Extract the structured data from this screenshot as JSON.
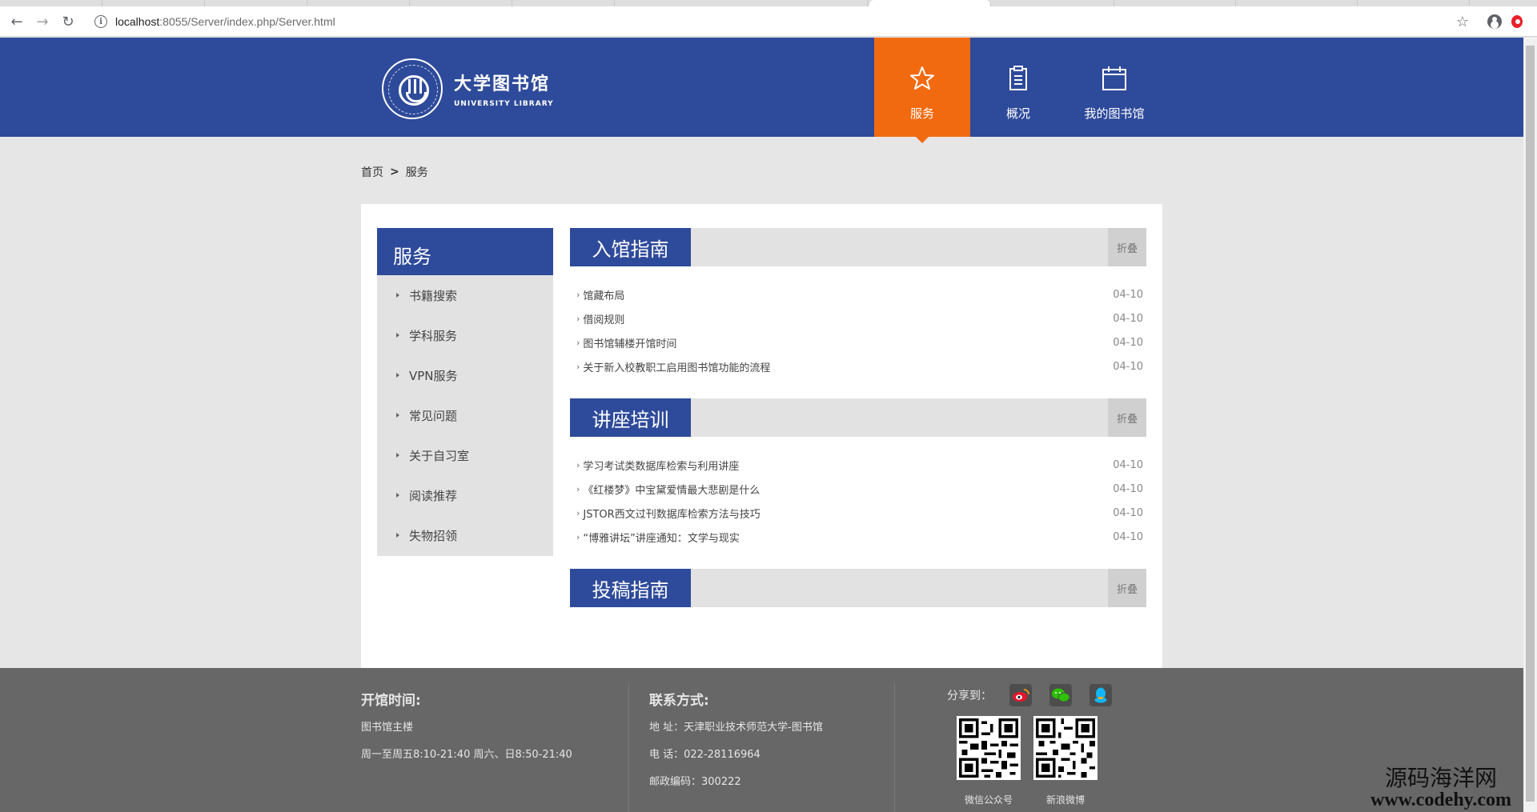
{
  "browser": {
    "url_host": "localhost",
    "url_path": ":8055/Server/index.php/Server.html"
  },
  "header": {
    "logo_cn": "大学图书馆",
    "logo_en": "UNIVERSITY LIBRARY",
    "nav": [
      {
        "label": "服务",
        "icon": "star-icon",
        "active": true
      },
      {
        "label": "概况",
        "icon": "clipboard-icon",
        "active": false
      },
      {
        "label": "我的图书馆",
        "icon": "calendar-icon",
        "active": false
      }
    ]
  },
  "breadcrumb": {
    "home": "首页",
    "separator": ">",
    "current": "服务"
  },
  "sidebar": {
    "title": "服务",
    "items": [
      {
        "label": "书籍搜索"
      },
      {
        "label": "学科服务"
      },
      {
        "label": "VPN服务"
      },
      {
        "label": "常见问题"
      },
      {
        "label": "关于自习室"
      },
      {
        "label": "阅读推荐"
      },
      {
        "label": "失物招领"
      }
    ]
  },
  "sections": [
    {
      "title": "入馆指南",
      "fold_label": "折叠",
      "items": [
        {
          "title": "馆藏布局",
          "date": "04-10"
        },
        {
          "title": "借阅规则",
          "date": "04-10"
        },
        {
          "title": "图书馆辅楼开馆时间",
          "date": "04-10"
        },
        {
          "title": "关于新入校教职工启用图书馆功能的流程",
          "date": "04-10"
        }
      ]
    },
    {
      "title": "讲座培训",
      "fold_label": "折叠",
      "items": [
        {
          "title": "学习考试类数据库检索与利用讲座",
          "date": "04-10"
        },
        {
          "title": "《红楼梦》中宝黛爱情最大悲剧是什么",
          "date": "04-10"
        },
        {
          "title": "JSTOR西文过刊数据库检索方法与技巧",
          "date": "04-10"
        },
        {
          "title": "“博雅讲坛”讲座通知：文学与现实",
          "date": "04-10"
        }
      ]
    },
    {
      "title": "投稿指南",
      "fold_label": "折叠",
      "items": []
    }
  ],
  "footer": {
    "hours": {
      "title": "开馆时间:",
      "lines": [
        "图书馆主楼",
        "周一至周五8:10-21:40 周六、日8:50-21:40"
      ]
    },
    "contact": {
      "title": "联系方式:",
      "lines": [
        "地 址：天津职业技术师范大学-图书馆",
        "电 话：022-28116964",
        "邮政编码：300222"
      ]
    },
    "share": {
      "label": "分享到：",
      "icons": [
        "weibo-icon",
        "wechat-icon",
        "qq-icon"
      ],
      "qr_labels": [
        "微信公众号",
        "新浪微博"
      ]
    }
  },
  "watermark": {
    "cn": "源码海洋网",
    "en": "www.codehy.com"
  },
  "colors": {
    "primary": "#2e4a9a",
    "accent": "#f26a0f",
    "footer": "#676767"
  }
}
